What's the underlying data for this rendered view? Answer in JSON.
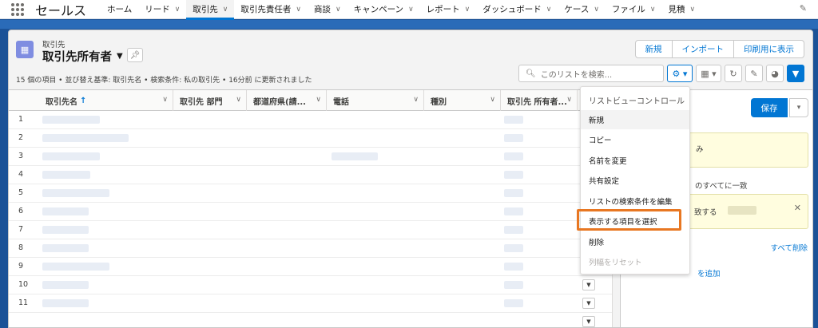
{
  "nav": {
    "app_name": "セールス",
    "items": [
      {
        "label": "ホーム",
        "has_menu": false
      },
      {
        "label": "リード",
        "has_menu": true
      },
      {
        "label": "取引先",
        "has_menu": true,
        "active": true
      },
      {
        "label": "取引先責任者",
        "has_menu": true
      },
      {
        "label": "商談",
        "has_menu": true
      },
      {
        "label": "キャンペーン",
        "has_menu": true
      },
      {
        "label": "レポート",
        "has_menu": true
      },
      {
        "label": "ダッシュボード",
        "has_menu": true
      },
      {
        "label": "ケース",
        "has_menu": true
      },
      {
        "label": "ファイル",
        "has_menu": true
      },
      {
        "label": "見積",
        "has_menu": true
      }
    ]
  },
  "header": {
    "object_label": "取引先",
    "view_name": "取引先所有者",
    "summary": "15 個の項目 • 並び替え基準: 取引先名 • 検索条件: 私の取引先 • 16分前 に更新されました",
    "buttons": [
      "新規",
      "インポート",
      "印刷用に表示"
    ],
    "search_placeholder": "このリストを検索..."
  },
  "table": {
    "columns": [
      "取引先名",
      "取引先 部門",
      "都道府県(請...",
      "電話",
      "種別",
      "取引先 所有者..."
    ],
    "row_numbers": [
      "1",
      "2",
      "3",
      "4",
      "5",
      "6",
      "7",
      "8",
      "9",
      "10",
      "11"
    ]
  },
  "menu": {
    "header": "リストビューコントロール",
    "items": [
      {
        "label": "新規",
        "state": "hover"
      },
      {
        "label": "コピー",
        "state": "normal"
      },
      {
        "label": "名前を変更",
        "state": "normal"
      },
      {
        "label": "共有設定",
        "state": "normal"
      },
      {
        "label": "リストの検索条件を編集",
        "state": "normal"
      },
      {
        "label": "表示する項目を選択",
        "state": "highlighted"
      },
      {
        "label": "削除",
        "state": "normal"
      },
      {
        "label": "列幅をリセット",
        "state": "disabled"
      }
    ]
  },
  "filter_panel": {
    "save_label": "保存",
    "card1_text": "み",
    "logic_text": "のすべてに一致",
    "card2_text": "致する",
    "remove_all": "すべて削除",
    "add_filter": "を追加"
  },
  "colors": {
    "brand_blue": "#0176d3",
    "highlight_orange": "#e87722",
    "filter_card_bg": "#fffddf"
  }
}
